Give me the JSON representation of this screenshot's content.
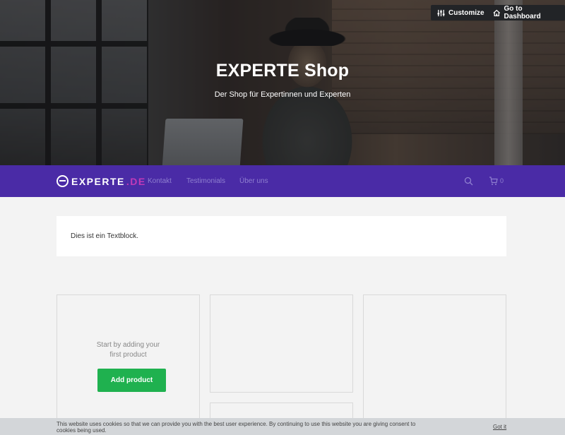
{
  "hero": {
    "title": "EXPERTE Shop",
    "subtitle": "Der Shop für Expertinnen und Experten"
  },
  "toolbar": {
    "customize_label": "Customize",
    "dashboard_label": "Go to Dashboard"
  },
  "nav": {
    "logo_text": "EXPERTE",
    "logo_suffix": ".DE",
    "links": [
      {
        "label": "Kontakt"
      },
      {
        "label": "Testimonials"
      },
      {
        "label": "Über uns"
      }
    ],
    "cart_count": "0",
    "icons": [
      "search-icon",
      "cart-icon"
    ]
  },
  "content": {
    "textblock": "Dies ist ein Textblock.",
    "empty_message_line1": "Start by adding your",
    "empty_message_line2": "first product",
    "add_product_label": "Add product"
  },
  "cookie_bar": {
    "text": "This website uses cookies so that we can provide you with the best user experience. By continuing to use this website you are giving consent to cookies being used.",
    "accept_label": "Got it"
  },
  "colors": {
    "nav_background": "#4a2ba6",
    "logo_accent": "#c03ab8",
    "add_button": "#1fb14f",
    "cookie_bar": "#d3d6d9"
  }
}
